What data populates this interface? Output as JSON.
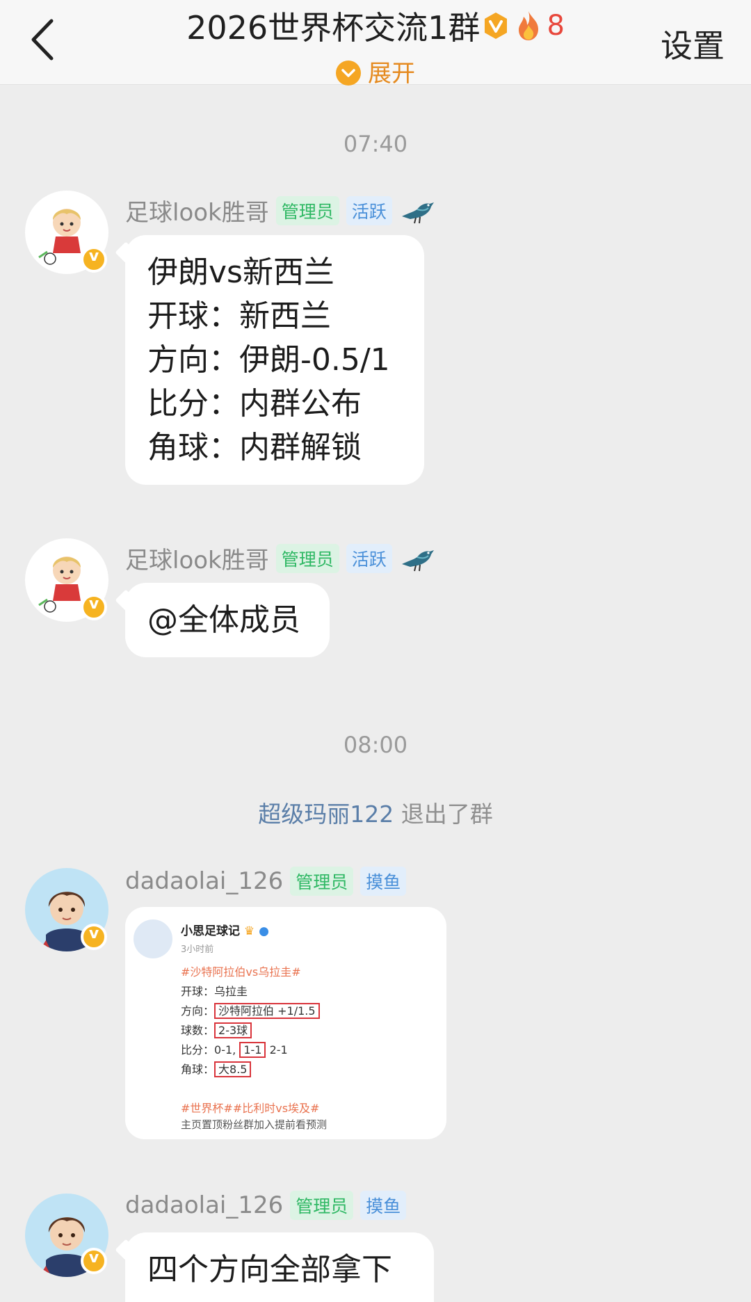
{
  "header": {
    "title": "2026世界杯交流1群",
    "fire_count": "8",
    "expand_label": "展开",
    "settings_label": "设置"
  },
  "colors": {
    "accent_orange": "#f5a623",
    "admin_tag": "#2fb864",
    "active_tag": "#4a90d9",
    "fire": "#e8473b"
  },
  "timeline": {
    "time1": "07:40",
    "time2": "08:00",
    "system_user": "超级玛丽122",
    "system_text": " 退出了群"
  },
  "messages": [
    {
      "sender": "足球look胜哥",
      "tags": [
        "管理员",
        "活跃"
      ],
      "lines": [
        "伊朗vs新西兰",
        "开球：新西兰",
        "方向：伊朗-0.5/1",
        "比分：内群公布",
        "角球：内群解锁"
      ]
    },
    {
      "sender": "足球look胜哥",
      "tags": [
        "管理员",
        "活跃"
      ],
      "lines": [
        "@全体成员"
      ]
    },
    {
      "sender": "dadaolai_126",
      "tags": [
        "管理员",
        "摸鱼"
      ],
      "image_card": {
        "author": "小思足球记",
        "time": "3小时前",
        "topic": "#沙特阿拉伯vs乌拉圭#",
        "kickoff_label": "开球：",
        "kickoff_value": "乌拉圭",
        "direction_label": "方向：",
        "direction_value": "沙特阿拉伯 +1/1.5",
        "goals_label": "球数：",
        "goals_value": "2-3球",
        "score_label": "比分：",
        "score_a": "0-1,",
        "score_b": "1-1",
        "score_c": "2-1",
        "corner_label": "角球：",
        "corner_value": "大8.5",
        "hashtags": "#世界杯##比利时vs埃及#",
        "footer": "主页置顶粉丝群加入提前看预测"
      }
    },
    {
      "sender": "dadaolai_126",
      "tags": [
        "管理员",
        "摸鱼"
      ],
      "lines": [
        "四个方向全部拿下"
      ]
    }
  ],
  "icons": {
    "back": "chevron-left-icon",
    "verified": "v-badge-icon",
    "fire": "fire-icon",
    "bird": "bird-icon"
  }
}
